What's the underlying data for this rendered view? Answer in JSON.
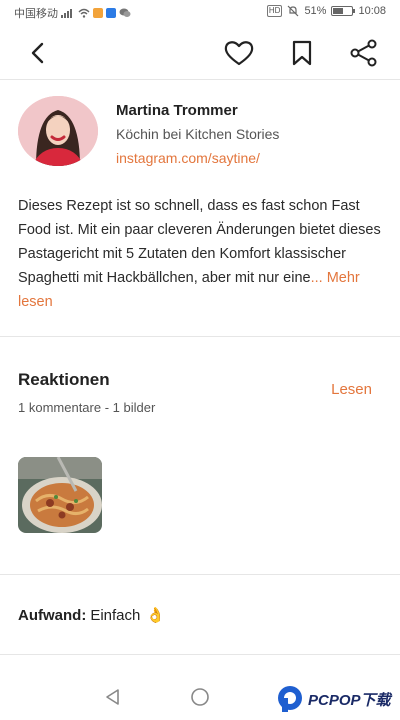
{
  "status_bar": {
    "carrier": "中国移动",
    "battery": "51%",
    "battery_level": 0.51,
    "time": "10:08",
    "hd_label": "HD"
  },
  "author": {
    "name": "Martina Trommer",
    "role": "Köchin bei Kitchen Stories",
    "link": "instagram.com/saytine/"
  },
  "description": {
    "text": "Dieses Rezept ist so schnell, dass es fast schon Fast Food ist. Mit ein paar cleveren Änderungen bietet dieses Pastagericht mit 5 Zutaten den Komfort klassischer Spaghetti mit Hackbällchen, aber mit nur eine",
    "ellipsis": "...",
    "more_label": "Mehr lesen"
  },
  "reactions": {
    "title": "Reaktionen",
    "read_label": "Lesen",
    "meta": "1 kommentare - 1 bilder"
  },
  "effort": {
    "label": "Aufwand:",
    "value": "Einfach",
    "emoji": "👌"
  },
  "watermark": {
    "text": "PCPOP下载"
  },
  "colors": {
    "accent": "#e3763d",
    "text": "#2b2b2b",
    "divider": "#e6e6e6"
  },
  "icons": [
    "back-arrow-icon",
    "heart-icon",
    "bookmark-icon",
    "share-icon",
    "back-triangle-icon",
    "home-circle-icon"
  ]
}
